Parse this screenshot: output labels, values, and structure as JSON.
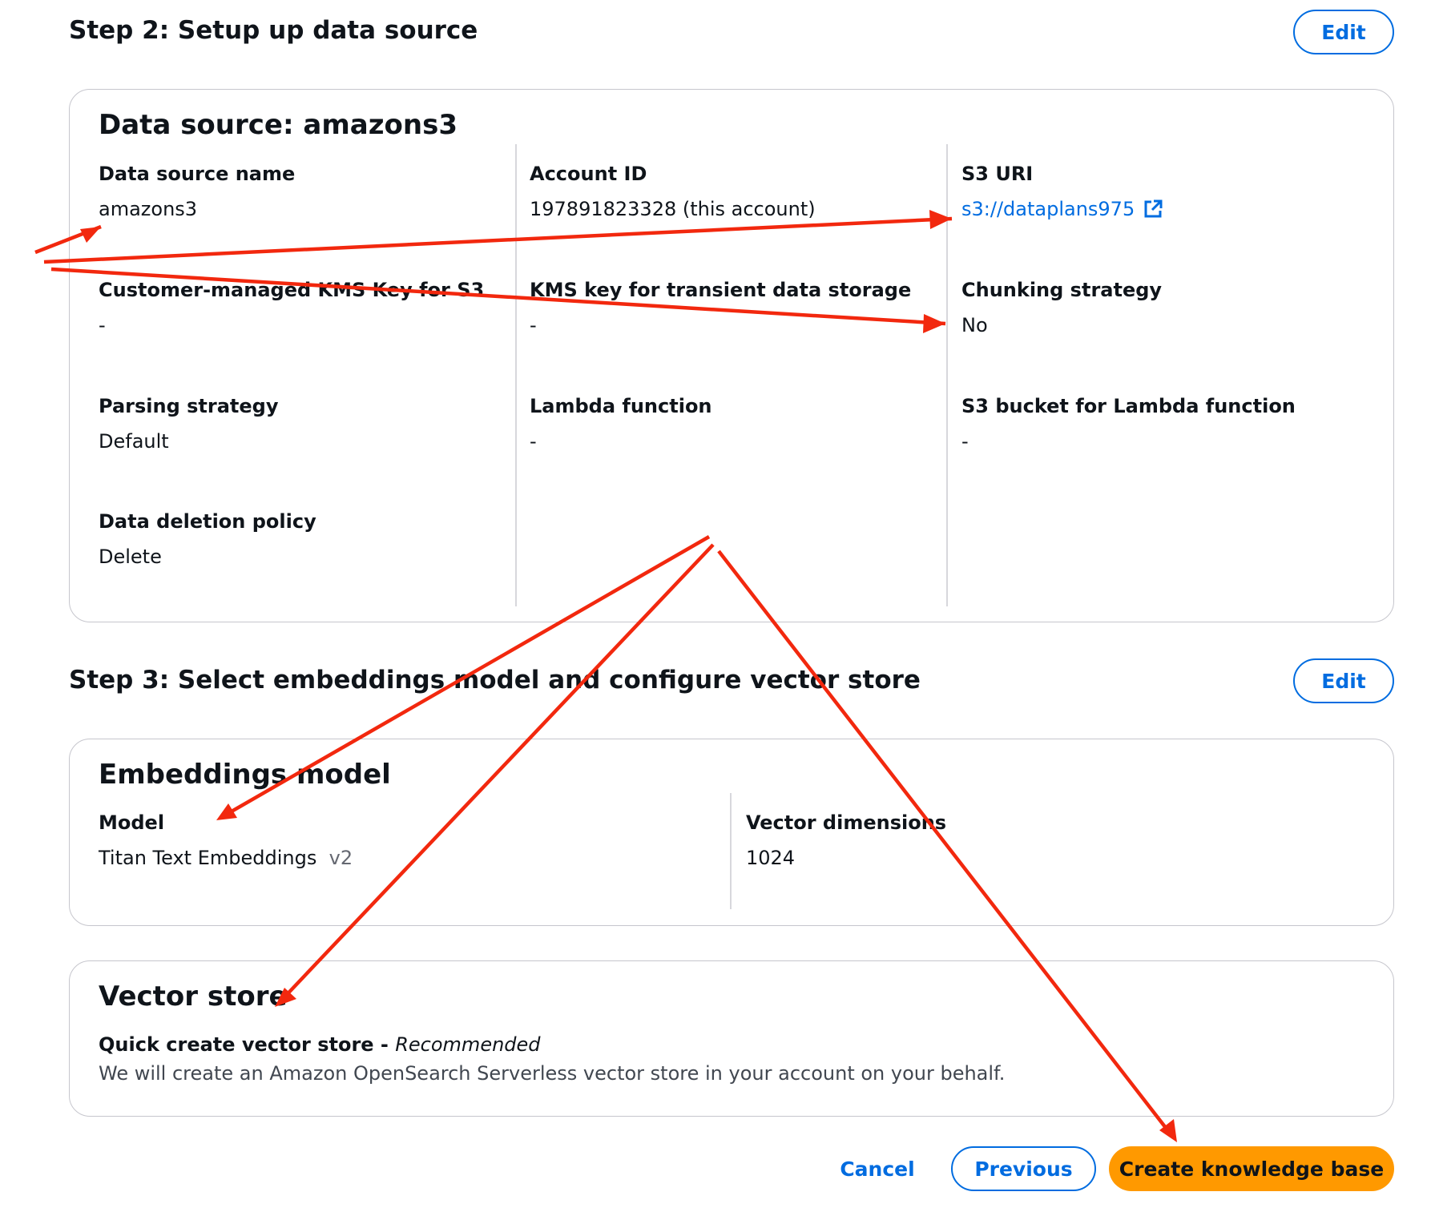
{
  "step2": {
    "title": "Step 2: Setup up data source",
    "edit_label": "Edit",
    "panel_title": "Data source: amazons3",
    "fields": {
      "data_source_name": {
        "label": "Data source name",
        "value": "amazons3"
      },
      "account_id": {
        "label": "Account ID",
        "value": "197891823328 (this account)"
      },
      "s3_uri": {
        "label": "S3 URI",
        "value": "s3://dataplans975",
        "icon": "external-link-icon"
      },
      "cmk": {
        "label": "Customer-managed KMS Key for S3",
        "value": "-"
      },
      "kms_transient": {
        "label": "KMS key for transient data storage",
        "value": "-"
      },
      "chunking": {
        "label": "Chunking strategy",
        "value": "No"
      },
      "parsing": {
        "label": "Parsing strategy",
        "value": "Default"
      },
      "lambda": {
        "label": "Lambda function",
        "value": "-"
      },
      "s3_lambda": {
        "label": "S3 bucket for Lambda function",
        "value": "-"
      },
      "deletion": {
        "label": "Data deletion policy",
        "value": "Delete"
      }
    }
  },
  "step3": {
    "title": "Step 3: Select embeddings model and configure vector store",
    "edit_label": "Edit",
    "embeddings": {
      "panel_title": "Embeddings model",
      "model_label": "Model",
      "model_value": "Titan Text Embeddings",
      "model_version": "v2",
      "dims_label": "Vector dimensions",
      "dims_value": "1024"
    },
    "vector_store": {
      "panel_title": "Vector store",
      "option_label": "Quick create vector store - ",
      "option_tag": "Recommended",
      "description": "We will create an Amazon OpenSearch Serverless vector store in your account on your behalf."
    }
  },
  "footer": {
    "cancel_label": "Cancel",
    "previous_label": "Previous",
    "create_label": "Create knowledge base"
  },
  "colors": {
    "accent": "#006ce0",
    "primary_button": "#ff9900",
    "annotation_arrow": "#f2280e"
  }
}
